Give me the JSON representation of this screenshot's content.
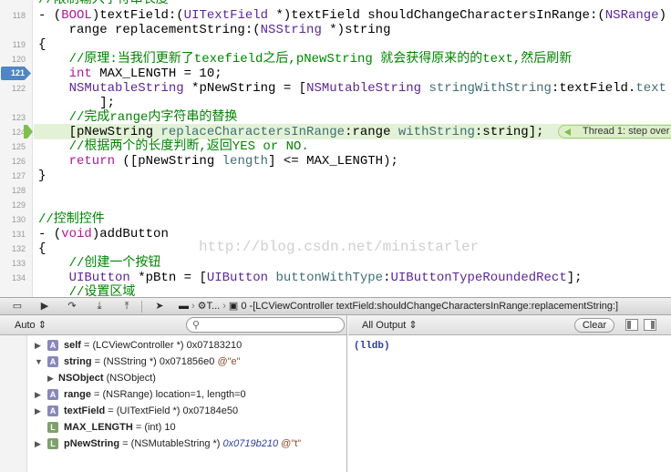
{
  "editor": {
    "gutter_numbers": [
      "118",
      "119",
      "120",
      "121",
      "122",
      "123",
      "124",
      "125",
      "126",
      "127",
      "128",
      "129",
      "130",
      "131",
      "132",
      "133",
      "134"
    ],
    "breakpoint_line": "121",
    "top_partial_comment": "//限制输入字符串长度",
    "l118_a": "- (",
    "l118_kw": "BOOL",
    "l118_b": ")",
    "l118_m": "textField",
    "l118_c": ":(",
    "l118_t": "UITextField",
    "l118_d": " *)textField shouldChangeCharactersInRange:(",
    "l118_t2": "NSRange",
    "l118_e": ")",
    "l119_a": "    range replacementString:(",
    "l119_t": "NSString",
    "l119_b": " *)string",
    "l120": "{",
    "l121_comment": "    //原理:当我们更新了texefield之后,pNewString 就会获得原来的的text,然后刷新",
    "l122_kw": "    int",
    "l122_rest": " MAX_LENGTH = 10;",
    "l123_t": "    NSMutableString",
    "l123_a": " *pNewString = [",
    "l123_t2": "NSMutableString",
    "l123_m": " stringWithString",
    "l123_b": ":textField.",
    "l123_m2": "text",
    "l124": "        ];",
    "l125_comment": "    //完成range内字符串的替换",
    "l126_a": "    [pNewString ",
    "l126_m": "replaceCharactersInRange",
    "l126_b": ":range ",
    "l126_m2": "withString",
    "l126_c": ":string];",
    "l127_comment": "    //根据两个的长度判断,返回YES or NO.",
    "l128_kw": "    return",
    "l128_a": " ([pNewString ",
    "l128_m": "length",
    "l128_b": "] <= MAX_LENGTH);",
    "l129": "}",
    "l132_comment": "//控制控件",
    "l133_a": "- (",
    "l133_kw": "void",
    "l133_b": ")addButton",
    "l134": "{",
    "l135_comment": "    //创建一个按钮",
    "l136_t": "    UIButton",
    "l136_a": " *pBtn = [",
    "l136_t2": "UIButton",
    "l136_m": " buttonWithType",
    "l136_b": ":",
    "l136_c": "UIButtonTypeRoundedRect",
    "l136_d": "];",
    "l137_comment": "    //设置区域",
    "thread_label": "Thread 1: step over",
    "watermark": "http://blog.csdn.net/ministarler"
  },
  "debugbar": {
    "jump_t": "T...",
    "jump_num": "0",
    "jump_frame": "-[LCViewController textField:shouldChangeCharactersInRange:replacementString:]"
  },
  "variables": {
    "scope": "Auto",
    "search_placeholder": "",
    "rows": [
      {
        "name": "self",
        "type": " = (LCViewController *) ",
        "value": "0x07183210",
        "summary": ""
      },
      {
        "name": "string",
        "type": " = (NSString *) ",
        "value": "0x071856e0",
        "summary": " @\"e\""
      },
      {
        "name": "NSObject",
        "type": " (NSObject)",
        "value": "",
        "summary": ""
      },
      {
        "name": "range",
        "type": " = (NSRange) ",
        "value": "location=1, length=0",
        "summary": ""
      },
      {
        "name": "textField",
        "type": " = (UITextField *) ",
        "value": "0x07184e50",
        "summary": ""
      },
      {
        "name": "MAX_LENGTH",
        "type": " = (int) ",
        "value": "10",
        "summary": ""
      },
      {
        "name": "pNewString",
        "type": " = (NSMutableString *) ",
        "value": "0x0719b210",
        "summary": " @\"t\""
      }
    ],
    "icon_letter_a": "A",
    "icon_letter_l": "L"
  },
  "console": {
    "output_selector": "All Output",
    "clear_label": "Clear",
    "prompt": "(lldb)"
  },
  "colors": {
    "keyword": "#b0179e",
    "type": "#5c2699",
    "comment": "#008400",
    "breakpoint": "#4f86c4",
    "pc_highlight": "#e3f2d6"
  }
}
